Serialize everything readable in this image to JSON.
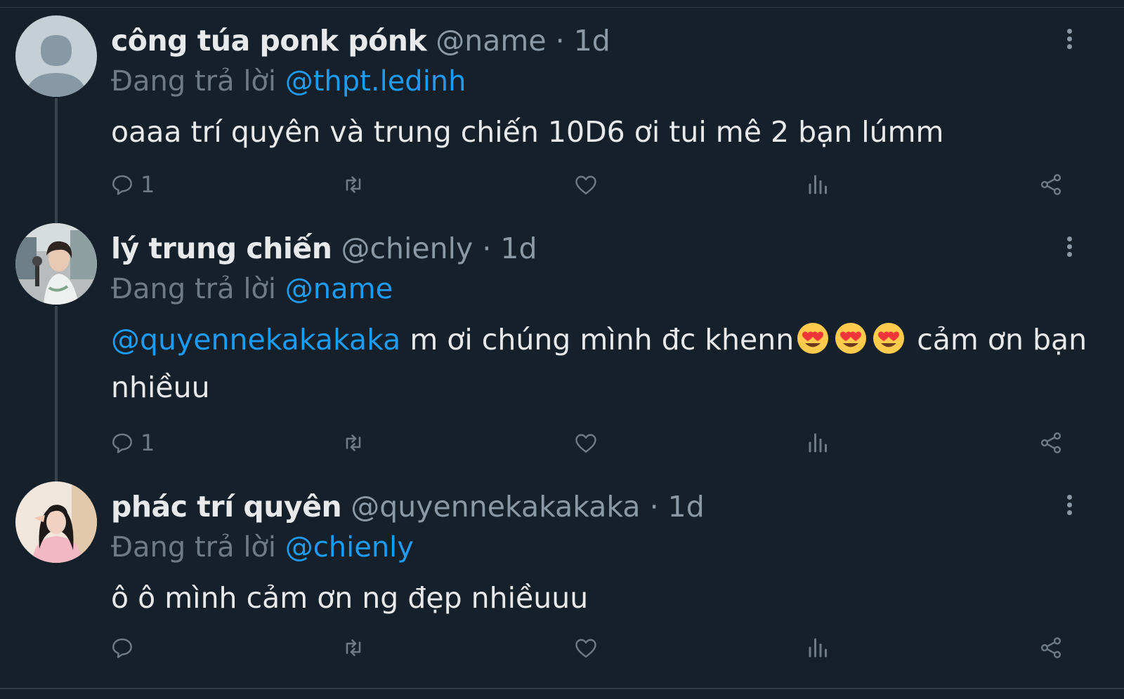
{
  "colors": {
    "background": "#15202b",
    "text": "#e7e9ea",
    "muted": "#8b98a5",
    "accent": "#1d9bf0"
  },
  "tweets": [
    {
      "display_name": "công túa ponk pónk",
      "handle": "@name",
      "separator": "·",
      "time": "1d",
      "replying_prefix": "Đang trả lời",
      "replying_to": "@thpt.ledinh",
      "text": "oaaa trí quyên và trung chiến 10D6 ơi tui mê 2 bạn lúmm",
      "reply_count": "1",
      "avatar": "default-avatar"
    },
    {
      "display_name": "lý trung chiến",
      "handle": "@chienly",
      "separator": "·",
      "time": "1d",
      "replying_prefix": "Đang trả lời",
      "replying_to": "@name",
      "text_mention": "@quyennekakakaka",
      "text_part1": " m ơi chúng mình đc khenn",
      "emoji": "heart-eyes-emoji",
      "text_part2": " cảm ơn bạn nhiềuu",
      "reply_count": "1",
      "avatar": "user-photo"
    },
    {
      "display_name": "phác trí quyên",
      "handle": "@quyennekakakaka",
      "separator": "·",
      "time": "1d",
      "replying_prefix": "Đang trả lời",
      "replying_to": "@chienly",
      "text": "ô ô mình cảm ơn ng đẹp nhiềuuu",
      "reply_count": "",
      "avatar": "user-photo"
    }
  ],
  "icons": [
    "reply-icon",
    "retweet-icon",
    "like-icon",
    "views-icon",
    "share-icon",
    "more-options-icon"
  ]
}
